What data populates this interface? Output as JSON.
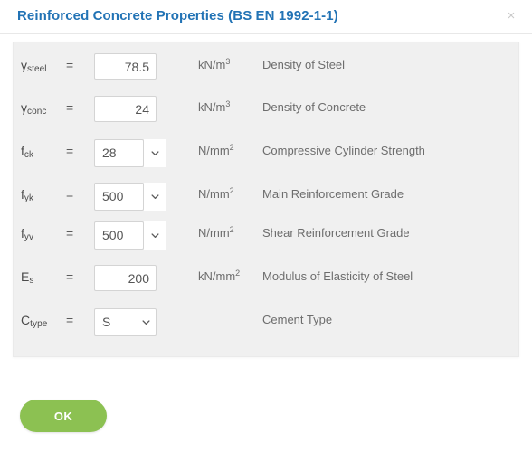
{
  "dialog": {
    "title": "Reinforced Concrete Properties (BS EN 1992-1-1)",
    "close_label": "×",
    "accent_blue": "#2273b5",
    "panel_bg": "#f0f0f0",
    "ok_color": "#8cc152"
  },
  "rows": [
    {
      "symbol_main": "γ",
      "symbol_sub": "steel",
      "equals": "=",
      "control": "number",
      "value": "78.5",
      "unit_main": "kN/m",
      "unit_sup": "3",
      "description": "Density of Steel"
    },
    {
      "symbol_main": "γ",
      "symbol_sub": "conc",
      "equals": "=",
      "control": "number",
      "value": "24",
      "unit_main": "kN/m",
      "unit_sup": "3",
      "description": "Density of Concrete"
    },
    {
      "symbol_main": "f",
      "symbol_sub": "ck",
      "equals": "=",
      "control": "split-select",
      "value": "28",
      "unit_main": "N/mm",
      "unit_sup": "2",
      "description": "Compressive Cylinder Strength"
    },
    {
      "symbol_main": "f",
      "symbol_sub": "yk",
      "equals": "=",
      "control": "split-select",
      "value": "500",
      "unit_main": "N/mm",
      "unit_sup": "2",
      "description": "Main Reinforcement Grade"
    },
    {
      "symbol_main": "f",
      "symbol_sub": "yv",
      "equals": "=",
      "control": "split-select",
      "value": "500",
      "unit_main": "N/mm",
      "unit_sup": "2",
      "description": "Shear Reinforcement Grade"
    },
    {
      "symbol_main": "E",
      "symbol_sub": "s",
      "equals": "=",
      "control": "number",
      "value": "200",
      "unit_main": "kN/mm",
      "unit_sup": "2",
      "description": "Modulus of Elasticity of Steel"
    },
    {
      "symbol_main": "C",
      "symbol_sub": "type",
      "equals": "=",
      "control": "full-select",
      "value": "S",
      "unit_main": "",
      "unit_sup": "",
      "description": "Cement Type"
    }
  ],
  "footer": {
    "ok_label": "OK"
  }
}
